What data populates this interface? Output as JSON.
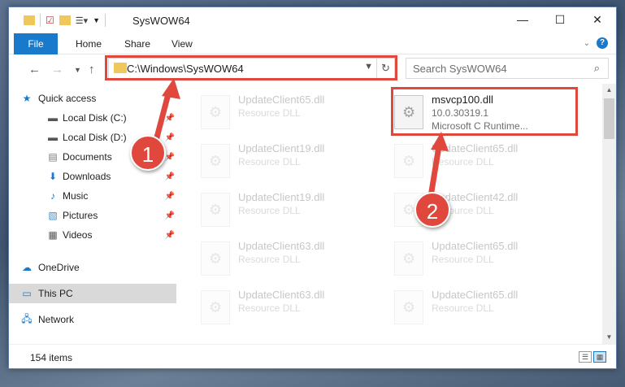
{
  "window": {
    "title": "SysWOW64"
  },
  "ribbon": {
    "tabs": [
      "File",
      "Home",
      "Share",
      "View"
    ]
  },
  "addressbar": {
    "path": "C:\\Windows\\SysWOW64"
  },
  "search": {
    "placeholder": "Search SysWOW64"
  },
  "sidebar": {
    "items": [
      {
        "label": "Quick access",
        "icon": "star-icon"
      },
      {
        "label": "Local Disk (C:)",
        "icon": "drive-icon"
      },
      {
        "label": "Local Disk (D:)",
        "icon": "drive-icon"
      },
      {
        "label": "Documents",
        "icon": "documents-icon"
      },
      {
        "label": "Downloads",
        "icon": "download-icon"
      },
      {
        "label": "Music",
        "icon": "music-icon"
      },
      {
        "label": "Pictures",
        "icon": "pictures-icon"
      },
      {
        "label": "Videos",
        "icon": "videos-icon"
      },
      {
        "label": "OneDrive",
        "icon": "cloud-icon"
      },
      {
        "label": "This PC",
        "icon": "computer-icon"
      },
      {
        "label": "Network",
        "icon": "network-icon"
      }
    ]
  },
  "files": {
    "left": [
      {
        "name": "UpdateClient65.dll",
        "type": "Resource DLL"
      },
      {
        "name": "UpdateClient19.dll",
        "type": "Resource DLL"
      },
      {
        "name": "UpdateClient19.dll",
        "type": "Resource DLL"
      },
      {
        "name": "UpdateClient63.dll",
        "type": "Resource DLL"
      },
      {
        "name": "UpdateClient63.dll",
        "type": "Resource DLL"
      }
    ],
    "highlighted": {
      "name": "msvcp100.dll",
      "version": "10.0.30319.1",
      "description": "Microsoft C Runtime..."
    },
    "right": [
      {
        "name": "UpdateClient65.dll",
        "type": "Resource DLL"
      },
      {
        "name": "UpdateClient42.dll",
        "type": "Resource DLL"
      },
      {
        "name": "UpdateClient65.dll",
        "type": "Resource DLL"
      },
      {
        "name": "UpdateClient65.dll",
        "type": "Resource DLL"
      }
    ]
  },
  "status": {
    "item_count": "154 items"
  },
  "annotations": {
    "step1": "1",
    "step2": "2"
  },
  "colors": {
    "accent": "#1979ca",
    "highlight": "#e0483e"
  }
}
